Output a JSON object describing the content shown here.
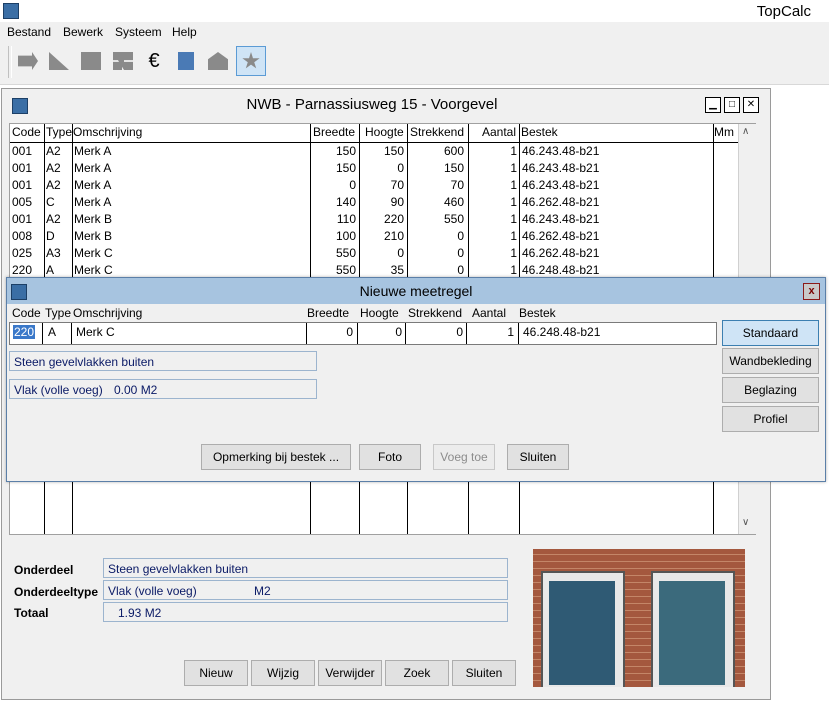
{
  "app": {
    "title": "TopCalc"
  },
  "menu": [
    "Bestand",
    "Bewerk",
    "Systeem",
    "Help"
  ],
  "toolbar": {
    "tools": [
      "tool-icon-1",
      "tool-icon-2",
      "tool-icon-3",
      "tool-icon-4",
      "euro-icon",
      "document-icon",
      "house-icon",
      "star-icon"
    ],
    "euro_glyph": "€"
  },
  "window": {
    "title": "NWB - Parnassiusweg 15 - Voorgevel",
    "columns": [
      "Code",
      "Type",
      "Omschrijving",
      "Breedte",
      "Hoogte",
      "Strekkend",
      "Aantal",
      "Bestek",
      "Mm"
    ],
    "rows": [
      [
        "001",
        "A2",
        "Merk A",
        "150",
        "150",
        "600",
        "1",
        "46.243.48-b21"
      ],
      [
        "001",
        "A2",
        "Merk A",
        "150",
        "0",
        "150",
        "1",
        "46.243.48-b21"
      ],
      [
        "001",
        "A2",
        "Merk A",
        "0",
        "70",
        "70",
        "1",
        "46.243.48-b21"
      ],
      [
        "005",
        "C",
        "Merk A",
        "140",
        "90",
        "460",
        "1",
        "46.262.48-b21"
      ],
      [
        "001",
        "A2",
        "Merk B",
        "110",
        "220",
        "550",
        "1",
        "46.243.48-b21"
      ],
      [
        "008",
        "D",
        "Merk B",
        "100",
        "210",
        "0",
        "1",
        "46.262.48-b21"
      ],
      [
        "025",
        "A3",
        "Merk C",
        "550",
        "0",
        "0",
        "1",
        "46.262.48-b21"
      ],
      [
        "220",
        "A",
        "Merk C",
        "550",
        "35",
        "0",
        "1",
        "46.248.48-b21"
      ]
    ],
    "onderdeel_label": "Onderdeel",
    "onderdeel_value": "Steen gevelvlakken buiten",
    "onderdeeltype_label": "Onderdeeltype",
    "onderdeeltype_value": "Vlak (volle voeg)",
    "onderdeeltype_unit": "M2",
    "totaal_label": "Totaal",
    "totaal_value": "1.93 M2",
    "buttons": [
      "Nieuw",
      "Wijzig",
      "Verwijder",
      "Zoek",
      "Sluiten"
    ]
  },
  "dialog": {
    "title": "Nieuwe meetregel",
    "columns": [
      "Code",
      "Type",
      "Omschrijving",
      "Breedte",
      "Hoogte",
      "Strekkend",
      "Aantal",
      "Bestek"
    ],
    "row": {
      "code": "220",
      "type": "A",
      "omschrijving": "Merk C",
      "breedte": "0",
      "hoogte": "0",
      "strekkend": "0",
      "aantal": "1",
      "bestek": "46.248.48-b21"
    },
    "onderdeel": "Steen gevelvlakken buiten",
    "vlak": "Vlak (volle voeg)",
    "vlak_value": "0.00 M2",
    "side_buttons": [
      "Standaard",
      "Wandbekleding",
      "Beglazing",
      "Profiel"
    ],
    "bottom_buttons": [
      "Opmerking bij bestek ...",
      "Foto",
      "Voeg toe",
      "Sluiten"
    ],
    "close_glyph": "x"
  }
}
